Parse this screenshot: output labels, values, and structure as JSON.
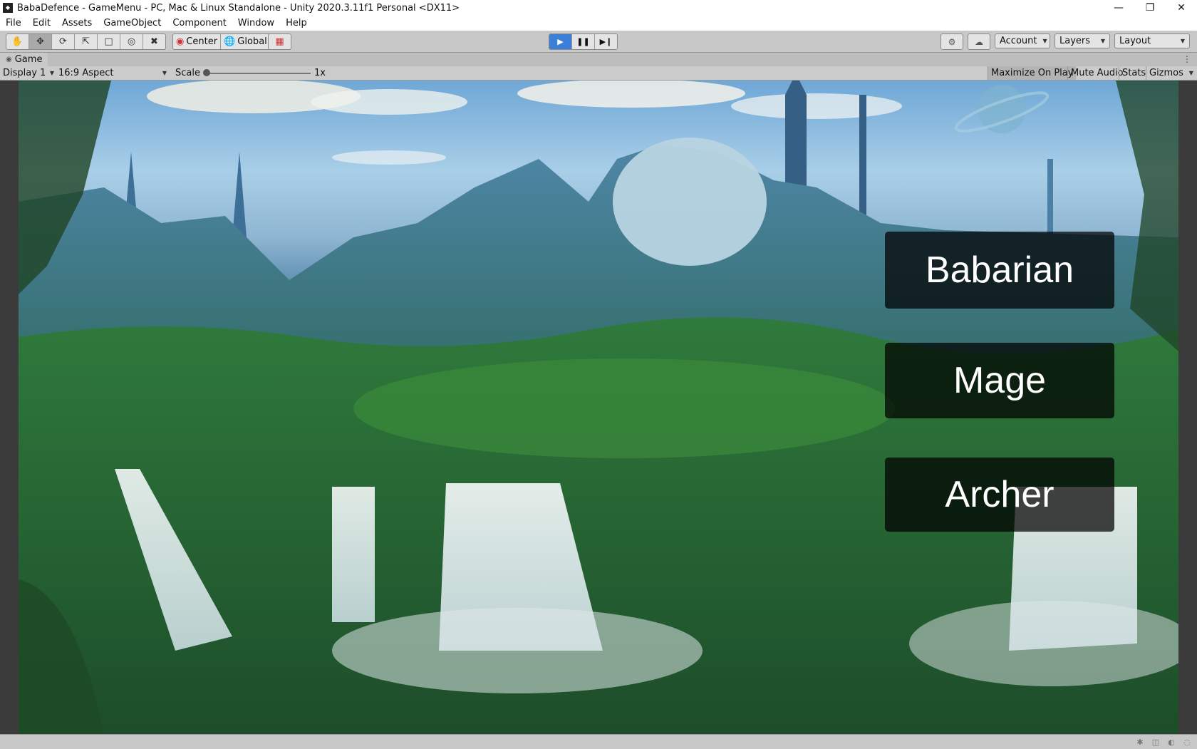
{
  "window": {
    "title": "BabaDefence - GameMenu - PC, Mac & Linux Standalone - Unity 2020.3.11f1 Personal <DX11>",
    "app_icon": "unity-icon",
    "controls": [
      "minimize",
      "restore",
      "close"
    ]
  },
  "menu": [
    "File",
    "Edit",
    "Assets",
    "GameObject",
    "Component",
    "Window",
    "Help"
  ],
  "toolbar": {
    "tools": [
      "hand-tool",
      "move-tool",
      "rotate-tool",
      "scale-tool",
      "rect-tool",
      "transform-tool",
      "custom-tool"
    ],
    "active_tool": "move-tool",
    "pivot_label": "Center",
    "space_label": "Global",
    "play_state": "playing",
    "account_label": "Account",
    "layers_label": "Layers",
    "layout_label": "Layout"
  },
  "game_tab": {
    "label": "Game"
  },
  "game_bar": {
    "display": "Display 1",
    "aspect": "16:9 Aspect",
    "scale_label": "Scale",
    "scale_value": "1x",
    "maximize_on_play": "Maximize On Play",
    "mute_audio": "Mute Audio",
    "stats": "Stats",
    "gizmos": "Gizmos"
  },
  "game_menu": {
    "buttons": [
      "Babarian",
      "Mage",
      "Archer"
    ]
  },
  "colors": {
    "play_active": "#3c7fd8",
    "editor_bg": "#c8c8c8",
    "button_overlay": "#000000"
  }
}
